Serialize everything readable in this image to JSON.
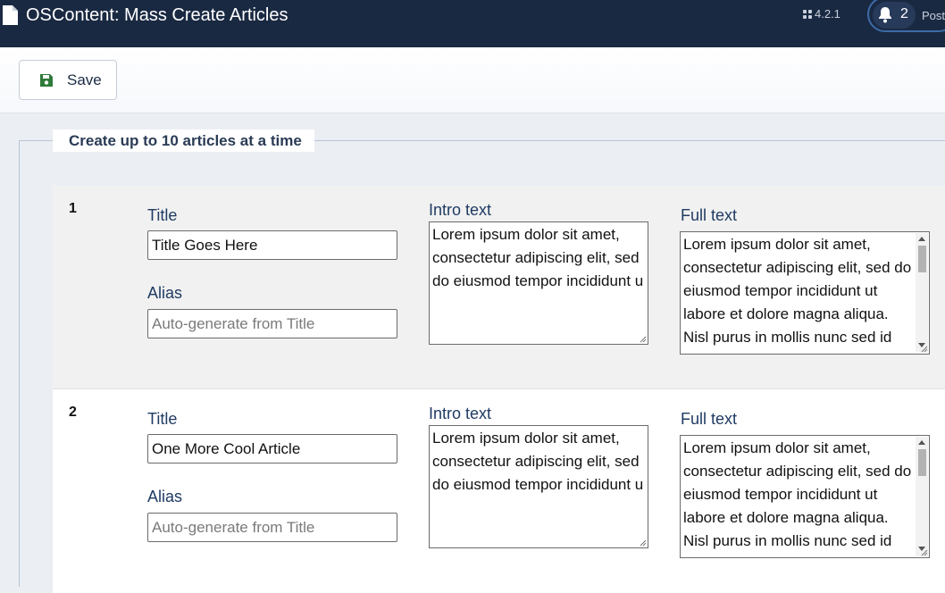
{
  "header": {
    "title": "OSContent: Mass Create Articles",
    "version": "4.2.1",
    "notification_count": "2",
    "post_label": "Post"
  },
  "toolbar": {
    "save_label": "Save"
  },
  "fieldset": {
    "legend": "Create up to 10 articles at a time"
  },
  "labels": {
    "title": "Title",
    "alias": "Alias",
    "intro": "Intro text",
    "full": "Full text",
    "alias_placeholder": "Auto-generate from Title"
  },
  "articles": [
    {
      "number": "1",
      "title": "Title Goes Here",
      "alias": "",
      "intro_text": "Lorem ipsum dolor sit amet, consectetur adipiscing elit, sed do eiusmod tempor incididunt u",
      "full_text": "Lorem ipsum dolor sit amet, consectetur adipiscing elit, sed do eiusmod tempor incididunt ut labore et dolore magna aliqua. Nisl purus in mollis nunc sed id"
    },
    {
      "number": "2",
      "title": "One More Cool Article",
      "alias": "",
      "intro_text": "Lorem ipsum dolor sit amet, consectetur adipiscing elit, sed do eiusmod tempor incididunt u",
      "full_text": "Lorem ipsum dolor sit amet, consectetur adipiscing elit, sed do eiusmod tempor incididunt ut labore et dolore magna aliqua. Nisl purus in mollis nunc sed id"
    }
  ],
  "colors": {
    "header_bg": "#1a2942",
    "save_icon": "#2f7a3a",
    "label_text": "#1f3b63"
  },
  "icons": {
    "page": "document-icon",
    "version": "joomla-icon",
    "notifications": "bell-icon",
    "save": "floppy-disk-icon"
  }
}
